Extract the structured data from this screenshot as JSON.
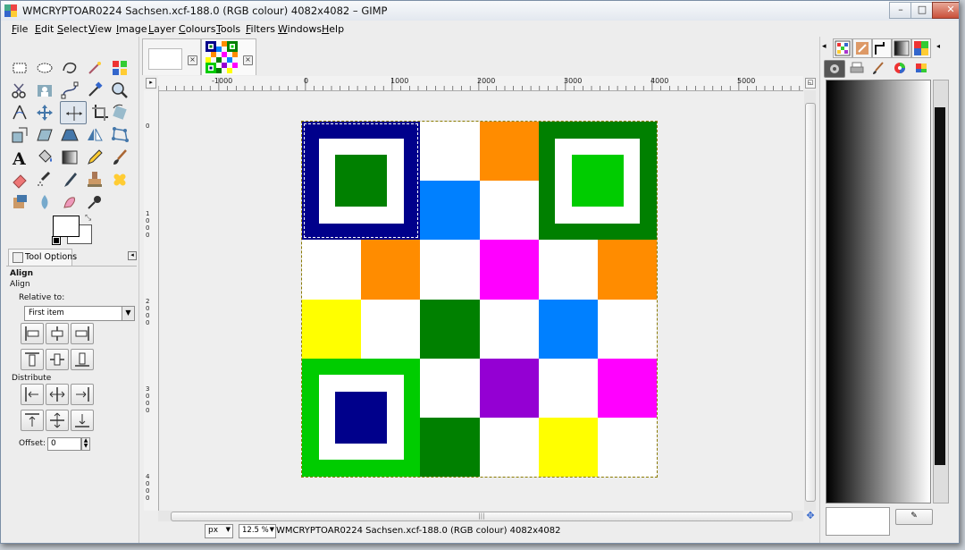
{
  "window": {
    "title": "WMCRYPTOAR0224 Sachsen.xcf-188.0 (RGB colour) 4082x4082 – GIMP",
    "minimize": "–",
    "maximize": "□",
    "close": "✕"
  },
  "menu": [
    {
      "label": "File"
    },
    {
      "label": "Edit"
    },
    {
      "label": "Select"
    },
    {
      "label": "View"
    },
    {
      "label": "Image"
    },
    {
      "label": "Layer"
    },
    {
      "label": "Colours"
    },
    {
      "label": "Tools"
    },
    {
      "label": "Filters"
    },
    {
      "label": "Windows"
    },
    {
      "label": "Help"
    }
  ],
  "tools": [
    "rect-select",
    "ellipse-select",
    "free-select",
    "fuzzy-select",
    "by-color-select",
    "scissors-select",
    "foreground-select",
    "paths",
    "color-picker",
    "zoom",
    "measure",
    "move",
    "align",
    "crop",
    "rotate",
    "scale",
    "shear",
    "perspective",
    "flip",
    "cage",
    "text",
    "bucket-fill",
    "blend",
    "pencil",
    "paintbrush",
    "eraser",
    "airbrush",
    "ink",
    "clone",
    "heal",
    "perspective-clone",
    "blur",
    "smudge",
    "dodge-burn"
  ],
  "tool_options": {
    "tab_label": "Tool Options",
    "title": "Align",
    "subtitle": "Align",
    "relative_label": "Relative to:",
    "relative_value": "First item",
    "distribute_label": "Distribute",
    "offset_label": "Offset:",
    "offset_value": "0"
  },
  "ruler": {
    "h_labels": [
      "-1000",
      "0",
      "1000",
      "2000",
      "3000",
      "4000",
      "5000"
    ],
    "v_labels": [
      "0",
      "1000",
      "2000",
      "3000",
      "4000"
    ]
  },
  "canvas": {
    "grid": [
      [
        "#00008b",
        "#00008b",
        "#ffffff",
        "#ff8c00",
        "#008000",
        "#008000"
      ],
      [
        "#00008b",
        "#00008b",
        "#0080ff",
        "#ffffff",
        "#008000",
        "#008000"
      ],
      [
        "#ffffff",
        "#ff8c00",
        "#ffffff",
        "#ff00ff",
        "#ffffff",
        "#ff8c00"
      ],
      [
        "#ffff00",
        "#ffffff",
        "#008000",
        "#ffffff",
        "#0080ff",
        "#ffffff"
      ],
      [
        "#00cc00",
        "#00cc00",
        "#ffffff",
        "#9400d3",
        "#ffffff",
        "#ff00ff"
      ],
      [
        "#00cc00",
        "#00cc00",
        "#008000",
        "#ffffff",
        "#ffff00",
        "#ffffff"
      ]
    ],
    "finders": [
      {
        "outer": "#00008b",
        "inner": "#008000"
      },
      {
        "outer": "#008000",
        "inner": "#00cc00"
      },
      {
        "outer": "#00cc00",
        "inner": "#00008b"
      }
    ]
  },
  "status": {
    "unit": "px",
    "zoom": "12.5 %",
    "message": "WMCRYPTOAR0224 Sachsen.xcf-188.0 (RGB colour) 4082x4082"
  }
}
